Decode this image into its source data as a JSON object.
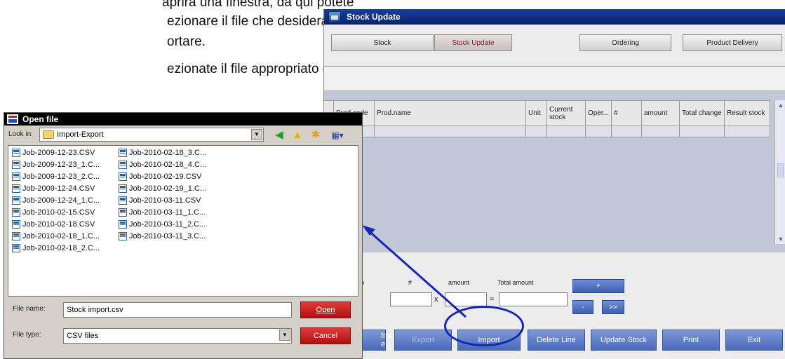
{
  "document": {
    "lines": [
      "aprirà una finestra, da qui potete",
      "ezionare il file che desiderate",
      "ortare.",
      "ezionate il file appropriato e apritelo"
    ]
  },
  "stock_window": {
    "title": "Stock Update",
    "tabs": [
      "Stock",
      "Stock Update",
      "Ordering",
      "Product Delivery"
    ],
    "active_tab": "Stock Update",
    "grid_headers": [
      "Prod.code",
      "Prod.name",
      "Unit",
      "Current stock",
      "Oper...",
      "#",
      "amount",
      "Total change",
      "Result stock"
    ],
    "fields": {
      "hash_label": "#",
      "amount_label": "amount",
      "total_amount_label": "Total amount",
      "times_sign": "x",
      "equals_sign": "=",
      "cut_label": "b"
    },
    "small_buttons": {
      "plus": "+",
      "minus": "-",
      "next": ">>"
    },
    "action_buttons": {
      "from_file_line1": "from",
      "from_file_line2": "e",
      "export": "Export",
      "import": "Import",
      "delete_line": "Delete Line",
      "update_stock": "Update Stock",
      "print": "Print",
      "exit": "Exit"
    }
  },
  "open_dialog": {
    "title": "Open file",
    "look_in_label": "Look in:",
    "look_in_value": "Import-Export",
    "files_col1": [
      "Job-2009-12-23.CSV",
      "Job-2009-12-23_1.C...",
      "Job-2009-12-23_2.C...",
      "Job-2009-12-24.CSV",
      "Job-2009-12-24_1.C...",
      "Job-2010-02-15.CSV",
      "Job-2010-02-18.CSV",
      "Job-2010-02-18_1.C...",
      "Job-2010-02-18_2.C..."
    ],
    "files_col2": [
      "Job-2010-02-18_3.C...",
      "Job-2010-02-18_4.C...",
      "Job-2010-02-19.CSV",
      "Job-2010-02-19_1.C...",
      "Job-2010-03-11.CSV",
      "Job-2010-03-11_1.C...",
      "Job-2010-03-11_2.C...",
      "Job-2010-03-11_3.C..."
    ],
    "file_name_label": "File name:",
    "file_name_value": "Stock import.csv",
    "file_type_label": "File type:",
    "file_type_value": "CSV files",
    "open_button": "Open",
    "cancel_button": "Cancel"
  },
  "colors": {
    "annotation": "#1526b8",
    "title_bar": "#0a246a",
    "dialog_button": "#c81818",
    "action_button": "#4a6ab8"
  }
}
